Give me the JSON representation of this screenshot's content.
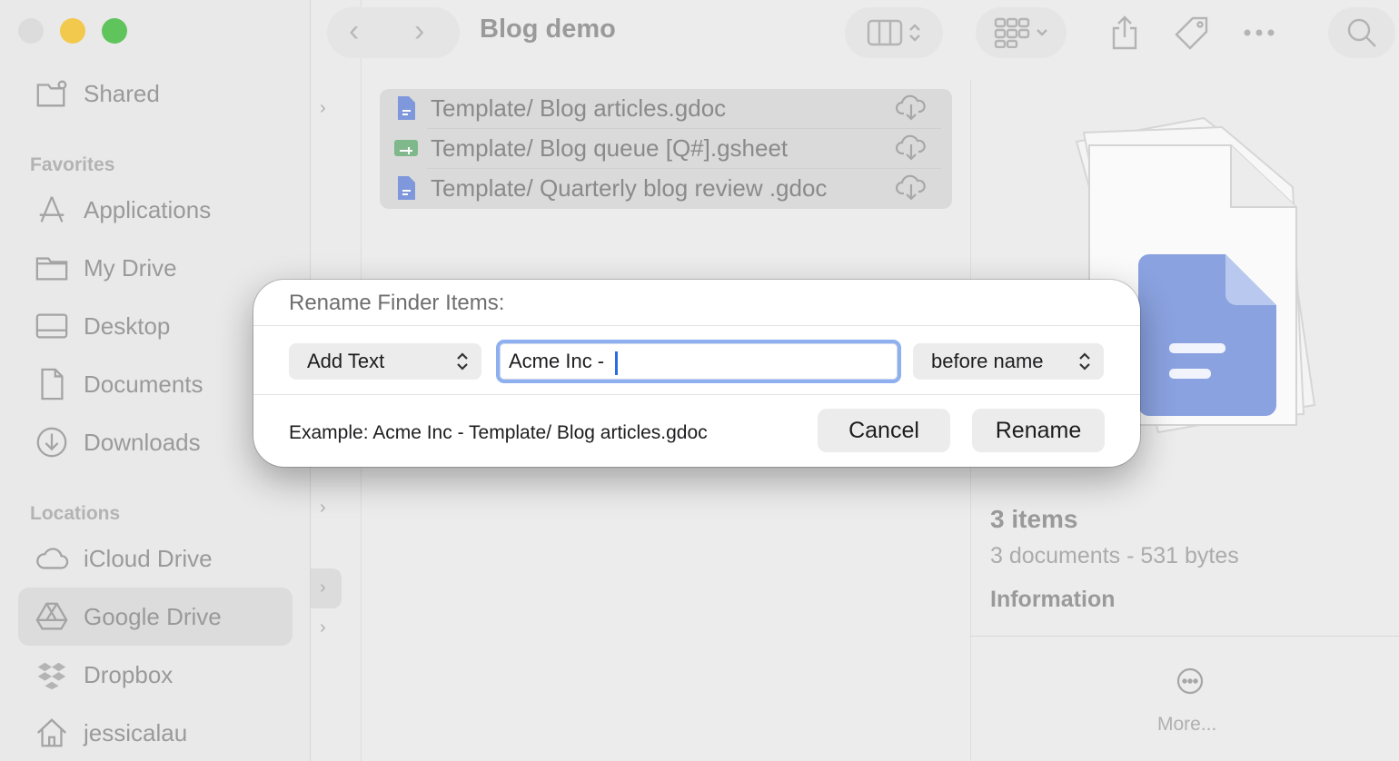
{
  "window": {
    "title": "Blog demo"
  },
  "sidebar": {
    "shared": "Shared",
    "favorites_header": "Favorites",
    "favorites": [
      {
        "label": "Applications",
        "icon": "applications-icon"
      },
      {
        "label": "My Drive",
        "icon": "folder-icon"
      },
      {
        "label": "Desktop",
        "icon": "desktop-icon"
      },
      {
        "label": "Documents",
        "icon": "document-icon"
      },
      {
        "label": "Downloads",
        "icon": "download-icon"
      }
    ],
    "locations_header": "Locations",
    "locations": [
      {
        "label": "iCloud Drive",
        "icon": "cloud-icon"
      },
      {
        "label": "Google Drive",
        "icon": "google-drive-icon",
        "active": true
      },
      {
        "label": "Dropbox",
        "icon": "dropbox-icon"
      },
      {
        "label": "jessicalau",
        "icon": "home-icon"
      }
    ]
  },
  "files": [
    {
      "name": "Template/ Blog articles.gdoc",
      "type": "gdoc"
    },
    {
      "name": "Template/ Blog queue [Q#].gsheet",
      "type": "gsheet"
    },
    {
      "name": "Template/ Quarterly blog review .gdoc",
      "type": "gdoc"
    }
  ],
  "preview": {
    "items": "3 items",
    "summary": "3 documents - 531 bytes",
    "information": "Information",
    "more": "More..."
  },
  "dialog": {
    "title": "Rename Finder Items:",
    "mode": "Add Text",
    "text_value": "Acme Inc - ",
    "position": "before name",
    "example": "Example: Acme Inc - Template/ Blog articles.gdoc",
    "cancel": "Cancel",
    "rename": "Rename"
  },
  "colors": {
    "accent": "#2d6be0",
    "gdoc": "#6f8fd8",
    "gsheet": "#5aa86a"
  }
}
